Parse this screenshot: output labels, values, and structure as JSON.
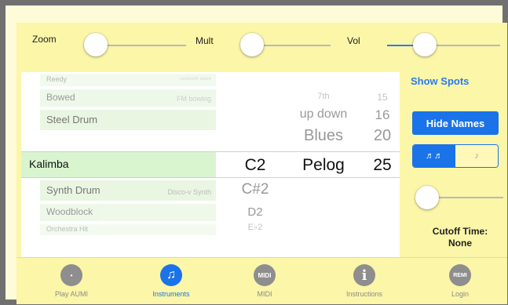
{
  "sliders": {
    "zoom_label": "Zoom",
    "mult_label": "Mult",
    "vol_label": "Vol",
    "zoom_value": 0.0,
    "mult_value": 0.0,
    "vol_value": 0.35
  },
  "instruments": {
    "items": [
      {
        "name": "Reedy",
        "sub": "sawtooth wave"
      },
      {
        "name": "Bowed",
        "sub": "FM bowing"
      },
      {
        "name": "Steel Drum",
        "sub": ""
      },
      {
        "name": "Kalimba",
        "sub": ""
      },
      {
        "name": "Synth Drum",
        "sub": "Disco-v Synth"
      },
      {
        "name": "Woodblock",
        "sub": ""
      },
      {
        "name": "Orchestra Hit",
        "sub": ""
      }
    ],
    "selected": "Kalimba"
  },
  "notes": [
    "C2",
    "C#2",
    "D2",
    "E♭2"
  ],
  "scales": [
    "7th",
    "up down",
    "Blues",
    "Pelog"
  ],
  "numbers": [
    "15",
    "16",
    "20",
    "25"
  ],
  "right_panel": {
    "show_spots": "Show Spots",
    "hide_names": "Hide Names",
    "seg_left": "♬♬",
    "seg_right": "♪",
    "cutoff_label": "Cutoff Time:",
    "cutoff_value": "None",
    "cutoff_slider_value": 0.0
  },
  "tabs": [
    {
      "label": "Play AUMI",
      "icon": "•"
    },
    {
      "label": "Instruments",
      "icon": "♫"
    },
    {
      "label": "MIDI",
      "icon": "MIDI"
    },
    {
      "label": "Instructions",
      "icon": "i"
    },
    {
      "label": "Login",
      "icon": "REMI"
    }
  ],
  "colors": {
    "accent": "#1a73e8",
    "panel": "#fbf6a8",
    "border": "#707070"
  }
}
